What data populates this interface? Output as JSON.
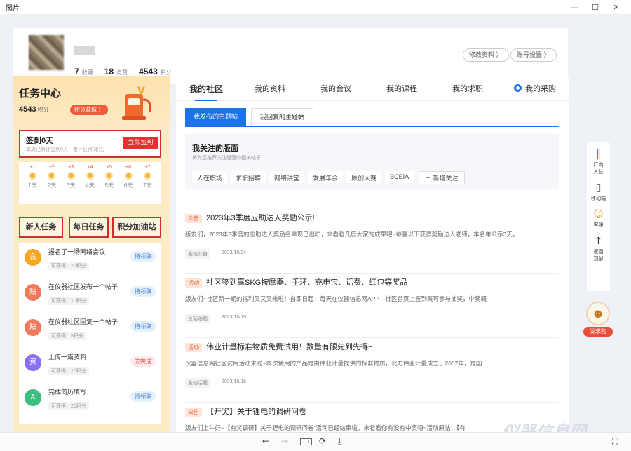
{
  "window": {
    "title": "图片",
    "minimize": "—",
    "maximize": "☐",
    "close": "✕"
  },
  "profile": {
    "stats": [
      {
        "value": "7",
        "label": "收藏"
      },
      {
        "value": "18",
        "label": "点赞"
      },
      {
        "value": "4543",
        "label": "积分"
      }
    ],
    "edit_profile": "修改资料 〉",
    "account_settings": "账号设置 〉"
  },
  "task_center": {
    "title": "任务中心",
    "points_value": "4543",
    "points_unit": "积分",
    "mall_button": "积分商城 〉",
    "sign_title": "签到0天",
    "sign_sub": "本周已累计签到0天，累计获得0积分",
    "sign_button": "立即签到",
    "days": [
      {
        "plus": "+1",
        "label": "1天"
      },
      {
        "plus": "+2",
        "label": "2天"
      },
      {
        "plus": "+3",
        "label": "3天"
      },
      {
        "plus": "+4",
        "label": "4天"
      },
      {
        "plus": "+5",
        "label": "5天"
      },
      {
        "plus": "+6",
        "label": "6天"
      },
      {
        "plus": "+7",
        "label": "7天"
      }
    ],
    "tabs": [
      "新人任务",
      "每日任务",
      "积分加油站"
    ],
    "tasks": [
      {
        "name": "报名了一场网络会议",
        "reward": "可获得：20积分",
        "status": "待领取",
        "icon": "会",
        "color": "#f5a623"
      },
      {
        "name": "在仪器社区发布一个帖子",
        "reward": "可获得：10积分",
        "status": "待领取",
        "icon": "贴",
        "color": "#f07a5c"
      },
      {
        "name": "在仪器社区回复一个帖子",
        "reward": "可获得：5积分",
        "status": "待领取",
        "icon": "贴",
        "color": "#f07a5c"
      },
      {
        "name": "上传一篇资料",
        "reward": "可获得：10积分",
        "status": "去完成",
        "icon": "资",
        "color": "#8a6ff0"
      },
      {
        "name": "完成简历填写",
        "reward": "可获得：20积分",
        "status": "待领取",
        "icon": "A",
        "color": "#3fbf7f"
      }
    ]
  },
  "main": {
    "tabs": [
      "我的社区",
      "我的资料",
      "我的会议",
      "我的课程",
      "我的求职",
      "我的采购"
    ],
    "subtabs": [
      "我发布的主题帖",
      "我回复的主题帖"
    ],
    "follow_title": "我关注的版面",
    "follow_sub": "将为您推荐关注版面的相关帖子",
    "follow_tags": [
      "人在职场",
      "求职招聘",
      "网络讲堂",
      "发展年会",
      "原创大赛",
      "BCEIA"
    ],
    "add_follow": "＋ 新增关注",
    "posts": [
      {
        "badge": "公告",
        "title": "2023年3季度应助达人奖励公示!",
        "desc": "版友们，2023年3季度的应助达人奖励名单现已出炉，来看看几度大家的成果吧~恭喜以下获得奖励达人老师，本名单公示3天，…",
        "category": "全站公告",
        "date": "2023/10/24"
      },
      {
        "badge": "活动",
        "title": "社区签到赢SKG按摩器、手环、充电宝、话费、红包等奖品",
        "desc": "版友们~社区新一期的福利又又又来啦！自即日起，每天在仪器信息网APP—社区首页上签到既可参与抽奖，中奖概",
        "category": "全站活题",
        "date": "2023/10/19"
      },
      {
        "badge": "活动",
        "title": "伟业计量标准物质免费试用！数量有限先到先得~",
        "desc": "仪器信息网社区试用活动来啦~本次使用的产品是由伟业计量提供的标准物质，北方伟业计量成立于2007年，是国",
        "category": "全站活题",
        "date": "2023/10/16"
      },
      {
        "badge": "公告",
        "title": "【开奖】关于锂电的调研问卷",
        "desc": "版友们上午好~【有奖调研】关于锂电的调研问卷\"活动已经结束啦，来看看你有没有中奖吧~活动原帖：【有",
        "category": "",
        "date": ""
      }
    ]
  },
  "floatbar": {
    "items": [
      {
        "icon": "‖",
        "label": "厂商\n入驻"
      },
      {
        "icon": "▯",
        "label": "移动端"
      },
      {
        "icon": "☺",
        "label": "客服"
      },
      {
        "icon": "↑",
        "label": "返回\n顶部"
      }
    ],
    "buy_label": "发求购"
  },
  "watermark": "仪器信息网",
  "toolbar": {
    "back": "←",
    "forward": "→",
    "actual": "1:1",
    "rotate": "⟳",
    "download": "⤓",
    "fullscreen": "⛶"
  }
}
